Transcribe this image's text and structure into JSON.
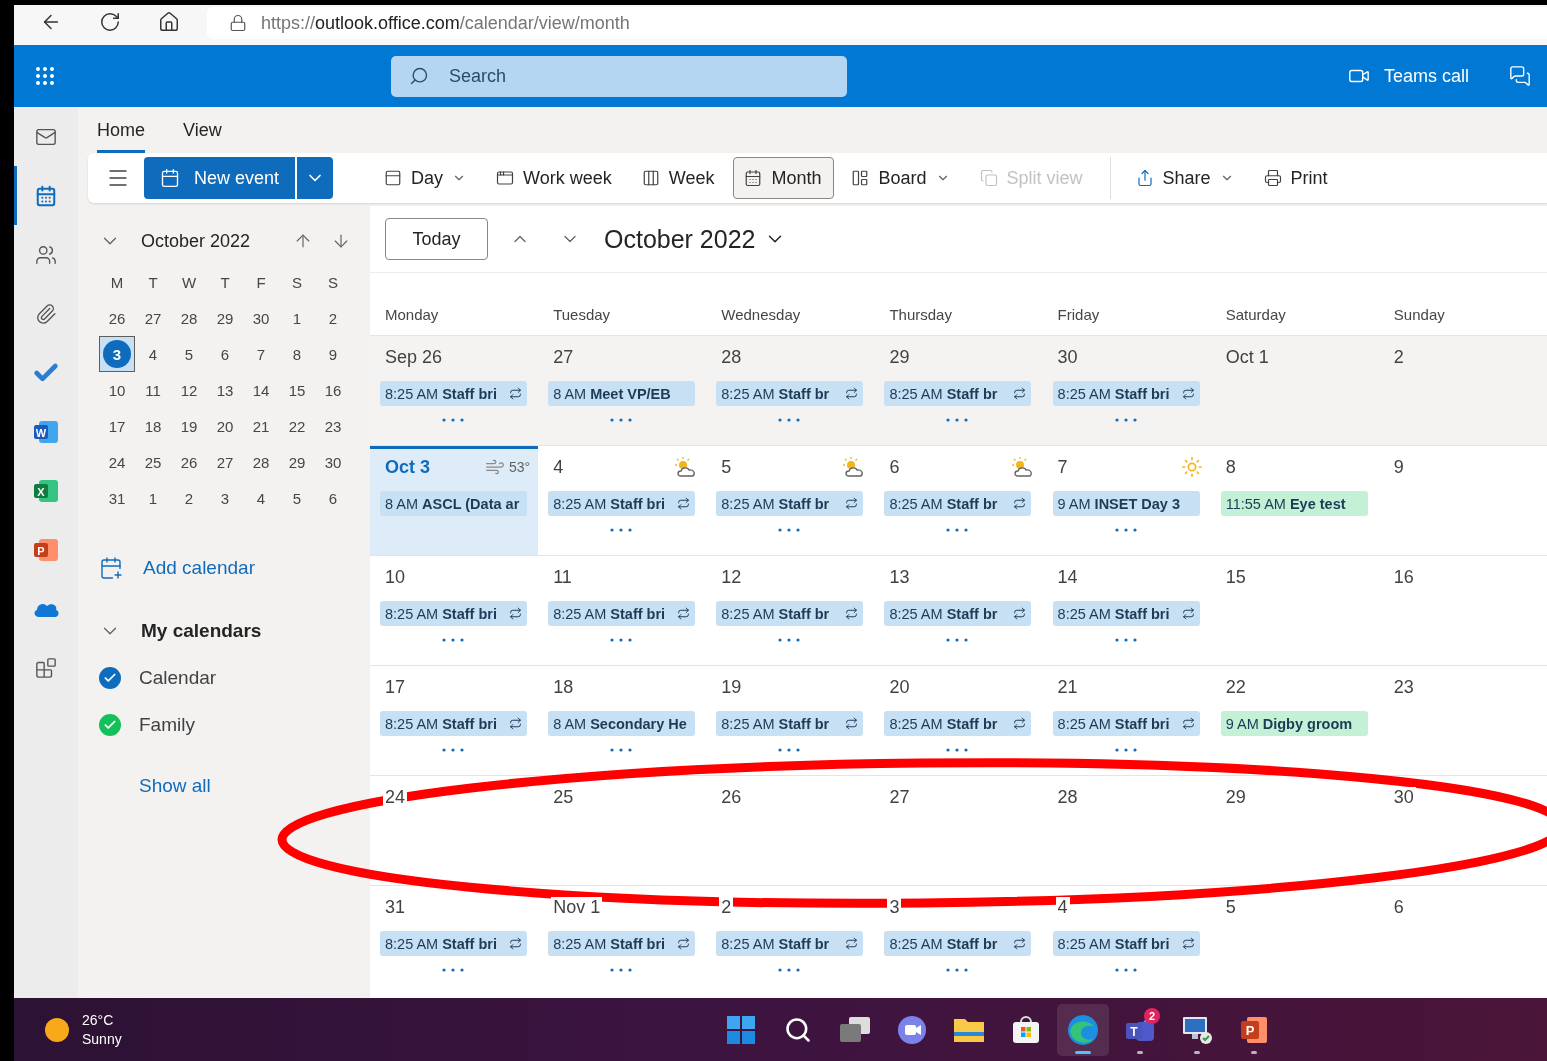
{
  "browser": {
    "url": {
      "scheme": "https://",
      "host": "outlook.office.com",
      "path": "/calendar/view/month"
    }
  },
  "header": {
    "search": {
      "placeholder": "Search"
    },
    "teams_call": "Teams call"
  },
  "rail": [
    {
      "kind": "mail",
      "selected": false
    },
    {
      "kind": "calendar",
      "selected": true
    },
    {
      "kind": "people",
      "selected": false
    },
    {
      "kind": "files",
      "selected": false
    },
    {
      "kind": "todo",
      "selected": false
    },
    {
      "kind": "word",
      "glyph": "W",
      "selected": false
    },
    {
      "kind": "excel",
      "glyph": "X",
      "selected": false
    },
    {
      "kind": "powerpoint",
      "glyph": "P",
      "selected": false
    },
    {
      "kind": "onedrive",
      "selected": false
    },
    {
      "kind": "apps",
      "selected": false
    }
  ],
  "ribbon_tabs": [
    {
      "label": "Home",
      "selected": true
    },
    {
      "label": "View",
      "selected": false
    }
  ],
  "toolbar": {
    "new_event": "New event",
    "views": [
      {
        "kind": "day",
        "label": "Day",
        "dropdown": true,
        "selected": false,
        "disabled": false
      },
      {
        "kind": "workweek",
        "label": "Work week",
        "dropdown": false,
        "selected": false,
        "disabled": false
      },
      {
        "kind": "week",
        "label": "Week",
        "dropdown": false,
        "selected": false,
        "disabled": false
      },
      {
        "kind": "month",
        "label": "Month",
        "dropdown": false,
        "selected": true,
        "disabled": false
      },
      {
        "kind": "board",
        "label": "Board",
        "dropdown": true,
        "selected": false,
        "disabled": false
      },
      {
        "kind": "split",
        "label": "Split view",
        "dropdown": false,
        "selected": false,
        "disabled": true
      }
    ],
    "actions": [
      {
        "kind": "share",
        "label": "Share",
        "dropdown": true
      },
      {
        "kind": "print",
        "label": "Print",
        "dropdown": false
      }
    ]
  },
  "mini_calendar": {
    "title": "October 2022",
    "weekdays": [
      "M",
      "T",
      "W",
      "T",
      "F",
      "S",
      "S"
    ],
    "weeks": [
      [
        {
          "day": "26",
          "selected": false
        },
        {
          "day": "27",
          "selected": false
        },
        {
          "day": "28",
          "selected": false
        },
        {
          "day": "29",
          "selected": false
        },
        {
          "day": "30",
          "selected": false
        },
        {
          "day": "1",
          "selected": false
        },
        {
          "day": "2",
          "selected": false
        }
      ],
      [
        {
          "day": "3",
          "selected": true
        },
        {
          "day": "4",
          "selected": false
        },
        {
          "day": "5",
          "selected": false
        },
        {
          "day": "6",
          "selected": false
        },
        {
          "day": "7",
          "selected": false
        },
        {
          "day": "8",
          "selected": false
        },
        {
          "day": "9",
          "selected": false
        }
      ],
      [
        {
          "day": "10",
          "selected": false
        },
        {
          "day": "11",
          "selected": false
        },
        {
          "day": "12",
          "selected": false
        },
        {
          "day": "13",
          "selected": false
        },
        {
          "day": "14",
          "selected": false
        },
        {
          "day": "15",
          "selected": false
        },
        {
          "day": "16",
          "selected": false
        }
      ],
      [
        {
          "day": "17",
          "selected": false
        },
        {
          "day": "18",
          "selected": false
        },
        {
          "day": "19",
          "selected": false
        },
        {
          "day": "20",
          "selected": false
        },
        {
          "day": "21",
          "selected": false
        },
        {
          "day": "22",
          "selected": false
        },
        {
          "day": "23",
          "selected": false
        }
      ],
      [
        {
          "day": "24",
          "selected": false
        },
        {
          "day": "25",
          "selected": false
        },
        {
          "day": "26",
          "selected": false
        },
        {
          "day": "27",
          "selected": false
        },
        {
          "day": "28",
          "selected": false
        },
        {
          "day": "29",
          "selected": false
        },
        {
          "day": "30",
          "selected": false
        }
      ],
      [
        {
          "day": "31",
          "selected": false
        },
        {
          "day": "1",
          "selected": false
        },
        {
          "day": "2",
          "selected": false
        },
        {
          "day": "3",
          "selected": false
        },
        {
          "day": "4",
          "selected": false
        },
        {
          "day": "5",
          "selected": false
        },
        {
          "day": "6",
          "selected": false
        }
      ]
    ]
  },
  "calendars_pane": {
    "add_calendar": "Add calendar",
    "group_title": "My calendars",
    "calendars": [
      {
        "name": "Calendar",
        "checked": true,
        "color": "#0f6cbd"
      },
      {
        "name": "Family",
        "checked": true,
        "color": "#13c15a"
      }
    ],
    "show_all": "Show all"
  },
  "main": {
    "today": "Today",
    "title": "October 2022",
    "weekdays": [
      "Monday",
      "Tuesday",
      "Wednesday",
      "Thursday",
      "Friday",
      "Saturday",
      "Sunday"
    ],
    "weeks": [
      {
        "past": true,
        "days": [
          {
            "label": "Sep 26",
            "today": false,
            "more": true,
            "events": [
              {
                "time": "8:25 AM",
                "title": "Staff bri",
                "recurring": true,
                "color": "#c7e0f4"
              }
            ]
          },
          {
            "label": "27",
            "today": false,
            "more": true,
            "events": [
              {
                "time": "8 AM",
                "title": "Meet VP/EB",
                "recurring": false,
                "color": "#c7e0f4"
              }
            ]
          },
          {
            "label": "28",
            "today": false,
            "more": true,
            "events": [
              {
                "time": "8:25 AM",
                "title": "Staff br",
                "recurring": true,
                "color": "#c7e0f4"
              }
            ]
          },
          {
            "label": "29",
            "today": false,
            "more": true,
            "events": [
              {
                "time": "8:25 AM",
                "title": "Staff br",
                "recurring": true,
                "color": "#c7e0f4"
              }
            ]
          },
          {
            "label": "30",
            "today": false,
            "more": true,
            "events": [
              {
                "time": "8:25 AM",
                "title": "Staff bri",
                "recurring": true,
                "color": "#c7e0f4"
              }
            ]
          },
          {
            "label": "Oct 1",
            "today": false,
            "more": false
          },
          {
            "label": "2",
            "today": false,
            "more": false
          }
        ]
      },
      {
        "past": false,
        "days": [
          {
            "label": "Oct 3",
            "today": true,
            "more": false,
            "weather": {
              "kind": "wind",
              "temp": "53°"
            },
            "events": [
              {
                "time": "8 AM",
                "title": "ASCL (Data ar",
                "recurring": false,
                "color": "#c7e0f4"
              }
            ]
          },
          {
            "label": "4",
            "today": false,
            "more": true,
            "weather": {
              "kind": "partly-cloudy"
            },
            "events": [
              {
                "time": "8:25 AM",
                "title": "Staff bri",
                "recurring": true,
                "color": "#c7e0f4"
              }
            ]
          },
          {
            "label": "5",
            "today": false,
            "more": true,
            "weather": {
              "kind": "partly-cloudy"
            },
            "events": [
              {
                "time": "8:25 AM",
                "title": "Staff br",
                "recurring": true,
                "color": "#c7e0f4"
              }
            ]
          },
          {
            "label": "6",
            "today": false,
            "more": true,
            "weather": {
              "kind": "partly-cloudy"
            },
            "events": [
              {
                "time": "8:25 AM",
                "title": "Staff br",
                "recurring": true,
                "color": "#c7e0f4"
              }
            ]
          },
          {
            "label": "7",
            "today": false,
            "more": true,
            "weather": {
              "kind": "sunny"
            },
            "events": [
              {
                "time": "9 AM",
                "title": "INSET Day 3",
                "recurring": false,
                "color": "#c7e0f4"
              }
            ]
          },
          {
            "label": "8",
            "today": false,
            "more": false,
            "events": [
              {
                "time": "11:55 AM",
                "title": "Eye test",
                "recurring": false,
                "color": "#c4f0d6"
              }
            ]
          },
          {
            "label": "9",
            "today": false,
            "more": false
          }
        ]
      },
      {
        "past": false,
        "days": [
          {
            "label": "10",
            "today": false,
            "more": true,
            "events": [
              {
                "time": "8:25 AM",
                "title": "Staff bri",
                "recurring": true,
                "color": "#c7e0f4"
              }
            ]
          },
          {
            "label": "11",
            "today": false,
            "more": true,
            "events": [
              {
                "time": "8:25 AM",
                "title": "Staff bri",
                "recurring": true,
                "color": "#c7e0f4"
              }
            ]
          },
          {
            "label": "12",
            "today": false,
            "more": true,
            "events": [
              {
                "time": "8:25 AM",
                "title": "Staff br",
                "recurring": true,
                "color": "#c7e0f4"
              }
            ]
          },
          {
            "label": "13",
            "today": false,
            "more": true,
            "events": [
              {
                "time": "8:25 AM",
                "title": "Staff br",
                "recurring": true,
                "color": "#c7e0f4"
              }
            ]
          },
          {
            "label": "14",
            "today": false,
            "more": true,
            "events": [
              {
                "time": "8:25 AM",
                "title": "Staff bri",
                "recurring": true,
                "color": "#c7e0f4"
              }
            ]
          },
          {
            "label": "15",
            "today": false,
            "more": false
          },
          {
            "label": "16",
            "today": false,
            "more": false
          }
        ]
      },
      {
        "past": false,
        "days": [
          {
            "label": "17",
            "today": false,
            "more": true,
            "events": [
              {
                "time": "8:25 AM",
                "title": "Staff bri",
                "recurring": true,
                "color": "#c7e0f4"
              }
            ]
          },
          {
            "label": "18",
            "today": false,
            "more": true,
            "events": [
              {
                "time": "8 AM",
                "title": "Secondary He",
                "recurring": false,
                "color": "#c7e0f4"
              }
            ]
          },
          {
            "label": "19",
            "today": false,
            "more": true,
            "events": [
              {
                "time": "8:25 AM",
                "title": "Staff br",
                "recurring": true,
                "color": "#c7e0f4"
              }
            ]
          },
          {
            "label": "20",
            "today": false,
            "more": true,
            "events": [
              {
                "time": "8:25 AM",
                "title": "Staff br",
                "recurring": true,
                "color": "#c7e0f4"
              }
            ]
          },
          {
            "label": "21",
            "today": false,
            "more": true,
            "events": [
              {
                "time": "8:25 AM",
                "title": "Staff bri",
                "recurring": true,
                "color": "#c7e0f4"
              }
            ]
          },
          {
            "label": "22",
            "today": false,
            "more": false,
            "events": [
              {
                "time": "9 AM",
                "title": "Digby groom",
                "recurring": false,
                "color": "#c4f0d6"
              }
            ]
          },
          {
            "label": "23",
            "today": false,
            "more": false
          }
        ]
      },
      {
        "past": false,
        "days": [
          {
            "label": "24",
            "today": false,
            "more": false
          },
          {
            "label": "25",
            "today": false,
            "more": false
          },
          {
            "label": "26",
            "today": false,
            "more": false
          },
          {
            "label": "27",
            "today": false,
            "more": false
          },
          {
            "label": "28",
            "today": false,
            "more": false
          },
          {
            "label": "29",
            "today": false,
            "more": false
          },
          {
            "label": "30",
            "today": false,
            "more": false
          }
        ]
      },
      {
        "past": false,
        "days": [
          {
            "label": "31",
            "today": false,
            "more": true,
            "events": [
              {
                "time": "8:25 AM",
                "title": "Staff bri",
                "recurring": true,
                "color": "#c7e0f4"
              }
            ]
          },
          {
            "label": "Nov 1",
            "today": false,
            "more": true,
            "events": [
              {
                "time": "8:25 AM",
                "title": "Staff bri",
                "recurring": true,
                "color": "#c7e0f4"
              }
            ]
          },
          {
            "label": "2",
            "today": false,
            "more": true,
            "events": [
              {
                "time": "8:25 AM",
                "title": "Staff br",
                "recurring": true,
                "color": "#c7e0f4"
              }
            ]
          },
          {
            "label": "3",
            "today": false,
            "more": true,
            "events": [
              {
                "time": "8:25 AM",
                "title": "Staff br",
                "recurring": true,
                "color": "#c7e0f4"
              }
            ]
          },
          {
            "label": "4",
            "today": false,
            "more": true,
            "events": [
              {
                "time": "8:25 AM",
                "title": "Staff bri",
                "recurring": true,
                "color": "#c7e0f4"
              }
            ]
          },
          {
            "label": "5",
            "today": false,
            "more": false
          },
          {
            "label": "6",
            "today": false,
            "more": false
          }
        ]
      }
    ]
  },
  "annotation": {
    "kind": "ellipse"
  },
  "taskbar": {
    "weather": {
      "temp": "26°C",
      "condition": "Sunny"
    },
    "apps": [
      {
        "kind": "start",
        "active": false,
        "running": false
      },
      {
        "kind": "search",
        "active": false,
        "running": false
      },
      {
        "kind": "taskview",
        "active": false,
        "running": false
      },
      {
        "kind": "chat",
        "active": false,
        "running": false
      },
      {
        "kind": "explorer",
        "active": false,
        "running": false
      },
      {
        "kind": "store",
        "active": false,
        "running": false
      },
      {
        "kind": "edge",
        "active": true,
        "running": true
      },
      {
        "kind": "teams",
        "glyph": "T",
        "badge": "2",
        "active": false,
        "running": true
      },
      {
        "kind": "remote",
        "active": false,
        "running": true
      },
      {
        "kind": "powerpoint",
        "glyph": "P",
        "active": false,
        "running": true
      }
    ]
  }
}
